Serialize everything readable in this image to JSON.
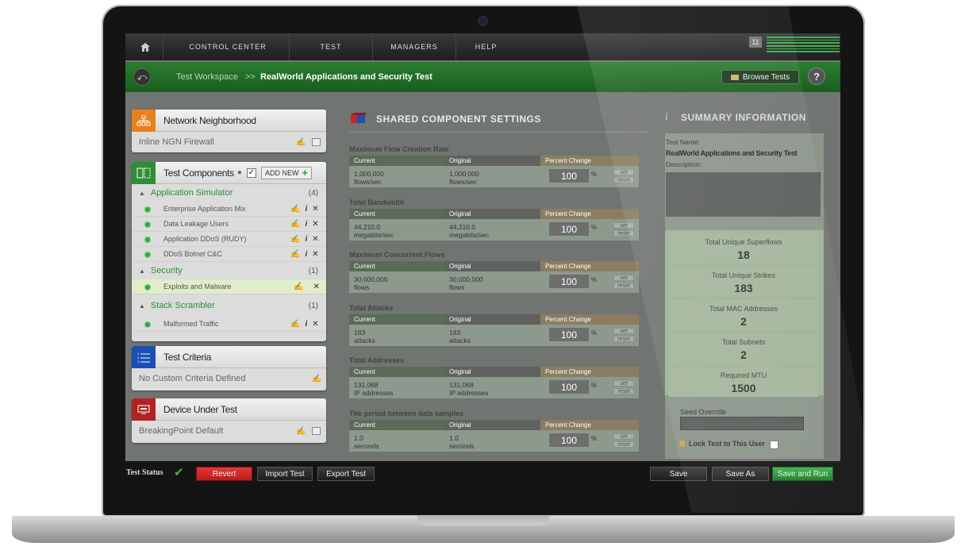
{
  "nav": {
    "items": [
      "CONTROL CENTER",
      "TEST",
      "MANAGERS",
      "HELP"
    ],
    "badge": "11"
  },
  "breadcrumb": {
    "parent": "Test Workspace",
    "separator": ">>",
    "current": "RealWorld Applications and Security Test"
  },
  "toolbar": {
    "browse_label": "Browse Tests",
    "help_label": "?"
  },
  "network": {
    "title": "Network Neighborhood",
    "value": "Inline NGN Firewall"
  },
  "components": {
    "title": "Test Components",
    "add_new": "ADD NEW",
    "groups": [
      {
        "name": "Application Simulator",
        "count": "(4)",
        "items": [
          "Enterprise Application Mix",
          "Data Leakage Users",
          "Application DDoS (RUDY)",
          "DDoS Botnet C&C"
        ]
      },
      {
        "name": "Security",
        "count": "(1)",
        "items": [
          "Exploits and Malware"
        ]
      },
      {
        "name": "Stack Scrambler",
        "count": "(1)",
        "items": [
          "Malformed Traffic"
        ]
      }
    ]
  },
  "criteria": {
    "title": "Test Criteria",
    "value": "No Custom Criteria Defined"
  },
  "dut": {
    "title": "Device Under Test",
    "value": "BreakingPoint Default"
  },
  "shared": {
    "title": "SHARED COMPONENT SETTINGS",
    "col_current": "Current",
    "col_original": "Original",
    "col_pct": "Percent Change",
    "set_label": "set",
    "reset_label": "reset",
    "pct_symbol": "%",
    "sections": [
      {
        "title": "Maximum Flow Creation Rate",
        "current": "1,000,000",
        "original": "1,000,000",
        "unit": "flows/sec",
        "pct": "100"
      },
      {
        "title": "Total Bandwidth",
        "current": "44,210.0",
        "original": "44,210.0",
        "unit": "megabits/sec",
        "pct": "100"
      },
      {
        "title": "Maximum Concurrent Flows",
        "current": "30,000,000",
        "original": "30,000,000",
        "unit": "flows",
        "pct": "100"
      },
      {
        "title": "Total Attacks",
        "current": "183",
        "original": "183",
        "unit": "attacks",
        "pct": "100"
      },
      {
        "title": "Total Addresses",
        "current": "131,068",
        "original": "131,068",
        "unit": "IP addresses",
        "pct": "100"
      },
      {
        "title": "The period between data samples",
        "current": "1.0",
        "original": "1.0",
        "unit": "seconds",
        "pct": "100"
      }
    ]
  },
  "summary": {
    "title": "SUMMARY INFORMATION",
    "test_name_label": "Test Name:",
    "test_name": "RealWorld Applications and Security Test",
    "description_label": "Description:",
    "stats": [
      {
        "label": "Total Unique Superflows",
        "value": "18"
      },
      {
        "label": "Total Unique Strikes",
        "value": "183"
      },
      {
        "label": "Total MAC Addresses",
        "value": "2"
      },
      {
        "label": "Total Subnets",
        "value": "2"
      },
      {
        "label": "Required MTU",
        "value": "1500"
      }
    ],
    "seed_label": "Seed Override",
    "seed_value": "",
    "lock_label": "Lock Test to This User"
  },
  "bottom": {
    "status_label": "Test Status",
    "revert": "Revert",
    "import": "Import Test",
    "export": "Export Test",
    "save": "Save",
    "save_as": "Save As",
    "save_run": "Save and Run"
  },
  "colors": {
    "accent_green": "#2a7e2f",
    "revert_red": "#c62828",
    "run_green": "#2e9a2e"
  }
}
